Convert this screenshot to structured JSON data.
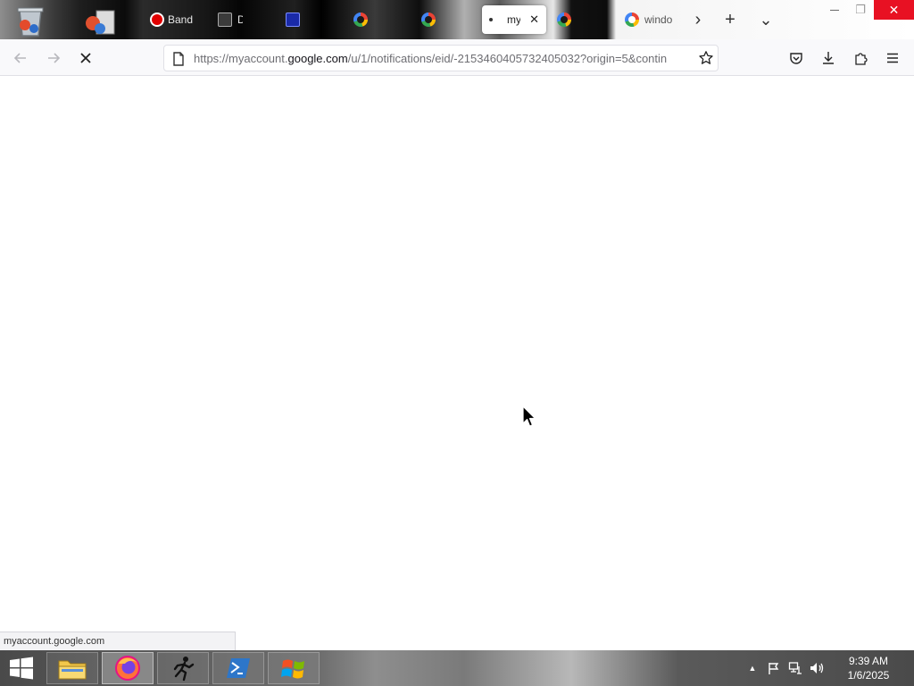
{
  "tabs": [
    {
      "label": "Band",
      "icon": "record-icon"
    },
    {
      "label": "D",
      "icon": "app-icon"
    },
    {
      "label": "",
      "icon": "app-icon"
    },
    {
      "label": "",
      "icon": "google-icon"
    },
    {
      "label": "",
      "icon": "google-icon"
    },
    {
      "label": "my",
      "icon": "loading-icon",
      "selected": true
    },
    {
      "label": "",
      "icon": "google-icon"
    },
    {
      "label": "windo",
      "icon": "google-icon"
    }
  ],
  "tab_close_glyph": "✕",
  "tabstrip_buttons": {
    "scroll_right": "›",
    "new_tab": "+",
    "list_all": "⌄"
  },
  "window_controls": {
    "minimize": "—",
    "maximize": "❐",
    "close": "✕"
  },
  "navbar": {
    "url_prefix": "https://myaccount.",
    "url_host": "google.com",
    "url_rest": "/u/1/notifications/eid/-2153460405732405032?origin=5&contin"
  },
  "status": {
    "text": "myaccount.google.com"
  },
  "taskbar": {
    "apps": [
      "start-button",
      "file-explorer",
      "firefox",
      "run-app",
      "powershell",
      "windows-app"
    ],
    "clock": {
      "time": "9:39 AM",
      "date": "1/6/2025"
    }
  },
  "colors": {
    "close_red": "#e81123",
    "accent": "#0061e0"
  }
}
